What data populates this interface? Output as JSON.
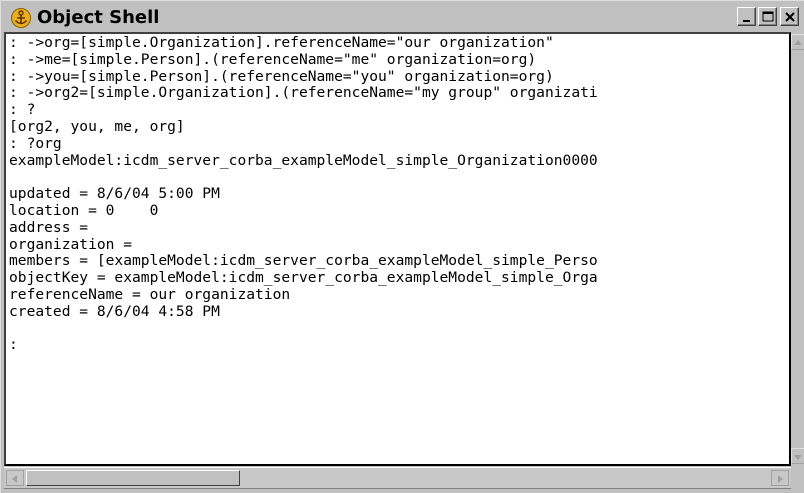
{
  "window": {
    "title": "Object Shell",
    "title_icon": "anchor-icon",
    "controls": [
      "minimize-icon",
      "maximize-icon",
      "close-icon"
    ]
  },
  "console": {
    "lines": [
      ": ->org=[simple.Organization].referenceName=\"our organization\"",
      ": ->me=[simple.Person].(referenceName=\"me\" organization=org)",
      ": ->you=[simple.Person].(referenceName=\"you\" organization=org)",
      ": ->org2=[simple.Organization].(referenceName=\"my group\" organizati",
      ": ?",
      "[org2, you, me, org]",
      ": ?org",
      "exampleModel:icdm_server_corba_exampleModel_simple_Organization0000",
      "",
      "updated = 8/6/04 5:00 PM",
      "location = 0    0",
      "address =",
      "organization =",
      "members = [exampleModel:icdm_server_corba_exampleModel_simple_Perso",
      "objectKey = exampleModel:icdm_server_corba_exampleModel_simple_Orga",
      "referenceName = our organization",
      "created = 8/6/04 4:58 PM",
      "",
      ":"
    ]
  },
  "colors": {
    "chrome": "#c0c0c0",
    "console_bg": "#ffffff",
    "text": "#000000"
  }
}
